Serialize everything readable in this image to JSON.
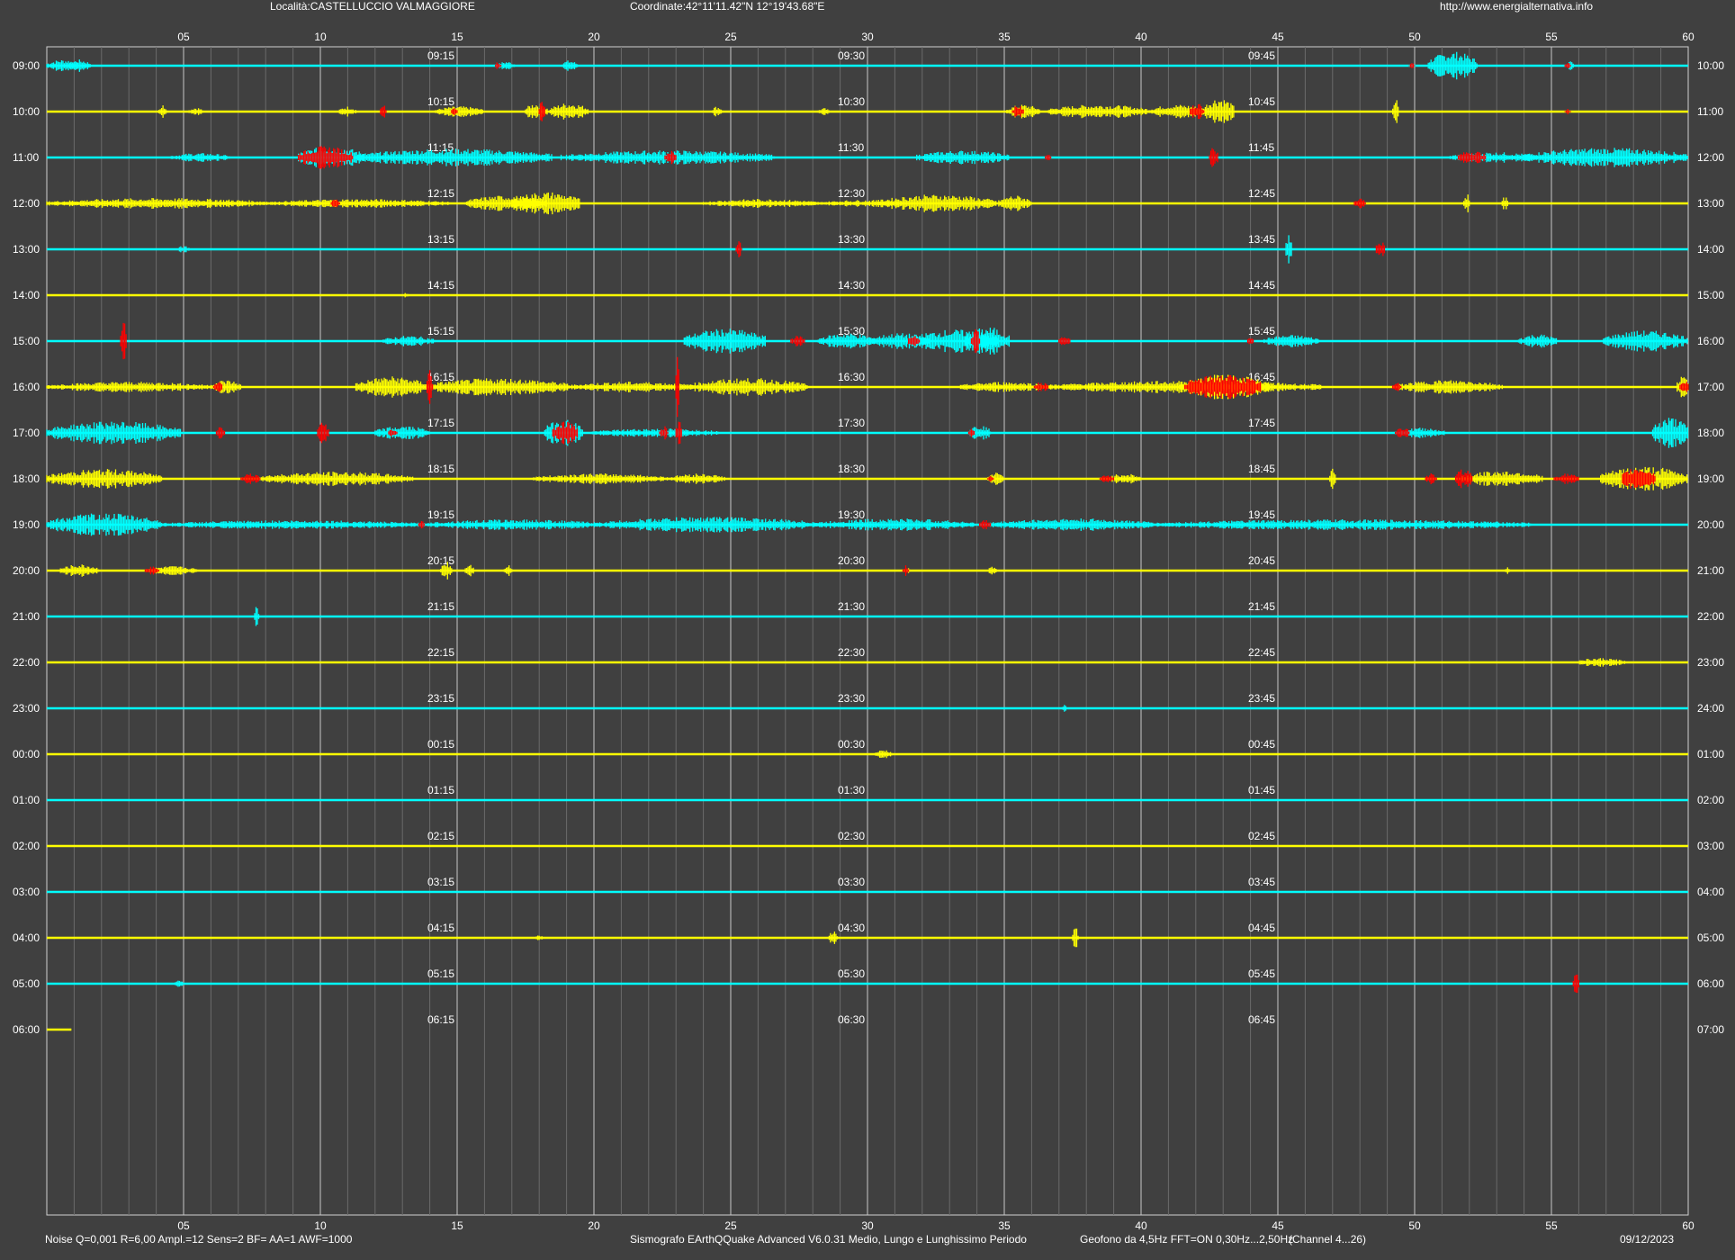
{
  "header": {
    "location": "Località:CASTELLUCCIO VALMAGGIORE",
    "coordinates": "Coordinate:42°11'11.42\"N  12°19'43.68\"E",
    "website": "http://www.energialternativa.info"
  },
  "footer": {
    "params": "Noise Q=0,001 R=6,00 Ampl.=12 Sens=2 BF= AA=1 AWF=1000",
    "software": "Sismografo  EArthQQuake Advanced V6.0.31  Medio, Lungo e Lunghissimo Periodo",
    "sensor": "Geofono da 4,5Hz FFT=ON 0,30Hz...2,50Hz",
    "channel": "(Channel 4...26)",
    "date": "09/12/2023"
  },
  "colors": {
    "background": "#404040",
    "grid": "#9a9a9a",
    "cyan": "#00ffff",
    "yellow": "#ffff00",
    "event": "#ff0000",
    "text": "#ffffff"
  },
  "chart_data": {
    "type": "line",
    "subtype": "helicorder",
    "xlim": [
      0,
      60
    ],
    "x_ticks": [
      "05",
      "10",
      "15",
      "20",
      "25",
      "30",
      "35",
      "40",
      "45",
      "50",
      "55",
      "60"
    ],
    "rows": [
      {
        "left": "09:00",
        "right": "10:00",
        "marks": [
          "09:15",
          "09:30",
          "09:45"
        ],
        "color": "cyan",
        "bursts": [
          [
            0,
            1.2,
            0.7
          ],
          [
            0.8,
            0.8,
            0.7
          ],
          [
            16.5,
            0.6,
            0.5
          ],
          [
            18.8,
            0.6,
            0.6
          ],
          [
            50.5,
            1.8,
            1.6
          ],
          [
            55.6,
            0.2,
            0.6
          ]
        ],
        "events": [
          [
            16.4,
            0.2,
            0.5
          ],
          [
            49.8,
            0.2,
            0.3
          ],
          [
            55.5,
            0.2,
            0.5
          ]
        ]
      },
      {
        "left": "10:00",
        "right": "11:00",
        "marks": [
          "10:15",
          "10:30",
          "10:45"
        ],
        "color": "yellow",
        "bursts": [
          [
            4.1,
            0.3,
            0.8
          ],
          [
            5.2,
            0.5,
            0.5
          ],
          [
            10.7,
            0.6,
            0.6
          ],
          [
            14.2,
            1.8,
            0.6
          ],
          [
            17.5,
            0.8,
            1.0
          ],
          [
            18.4,
            1.4,
            1.0
          ],
          [
            24.3,
            0.4,
            0.6
          ],
          [
            28.2,
            0.4,
            0.4
          ],
          [
            35.1,
            1.2,
            0.8
          ],
          [
            36.6,
            3.7,
            0.8
          ],
          [
            40.3,
            2.1,
            0.8
          ],
          [
            42.3,
            1.1,
            1.6
          ],
          [
            49.2,
            0.2,
            1.6
          ]
        ],
        "events": [
          [
            12.2,
            0.2,
            0.9
          ],
          [
            14.8,
            0.2,
            0.5
          ],
          [
            18.0,
            0.2,
            1.8
          ],
          [
            35.3,
            0.4,
            0.7
          ],
          [
            41.8,
            0.5,
            1.0
          ],
          [
            55.5,
            0.2,
            0.3
          ]
        ]
      },
      {
        "left": "11:00",
        "right": "12:00",
        "marks": [
          "11:15",
          "11:30",
          "11:45"
        ],
        "color": "cyan",
        "bursts": [
          [
            4.5,
            2.2,
            0.5
          ],
          [
            9.2,
            2.4,
            1.3
          ],
          [
            11.3,
            7.2,
            1.0
          ],
          [
            18.8,
            7.8,
            0.8
          ],
          [
            31.8,
            3.4,
            0.8
          ],
          [
            51.3,
            3.2,
            0.6
          ],
          [
            54.0,
            6.0,
            1.1
          ]
        ],
        "events": [
          [
            9.2,
            2.0,
            1.3
          ],
          [
            22.6,
            0.4,
            0.8
          ],
          [
            36.5,
            0.2,
            0.5
          ],
          [
            42.5,
            0.3,
            1.4
          ],
          [
            51.6,
            1.0,
            0.8
          ]
        ]
      },
      {
        "left": "12:00",
        "right": "13:00",
        "marks": [
          "12:15",
          "12:30",
          "12:45"
        ],
        "color": "yellow",
        "bursts": [
          [
            0,
            8.2,
            0.6
          ],
          [
            8.2,
            6.5,
            0.5
          ],
          [
            15.3,
            3.0,
            0.9
          ],
          [
            17.0,
            2.5,
            1.3
          ],
          [
            24.0,
            4.2,
            0.5
          ],
          [
            28.3,
            3.1,
            0.4
          ],
          [
            30.4,
            4.3,
            1.0
          ],
          [
            34.8,
            1.2,
            0.9
          ],
          [
            51.8,
            0.2,
            1.2
          ],
          [
            53.2,
            0.2,
            0.8
          ]
        ],
        "events": [
          [
            10.4,
            0.3,
            0.5
          ],
          [
            47.8,
            0.4,
            0.8
          ]
        ]
      },
      {
        "left": "13:00",
        "right": "14:00",
        "marks": [
          "13:15",
          "13:30",
          "13:45"
        ],
        "color": "cyan",
        "bursts": [
          [
            4.8,
            0.4,
            0.4
          ],
          [
            45.3,
            0.2,
            2.0
          ]
        ],
        "events": [
          [
            25.2,
            0.2,
            0.9
          ],
          [
            48.6,
            0.3,
            1.1
          ]
        ]
      },
      {
        "left": "14:00",
        "right": "15:00",
        "marks": [
          "14:15",
          "14:30",
          "14:45"
        ],
        "color": "yellow",
        "bursts": [
          [
            13.0,
            0.3,
            0.3
          ]
        ],
        "events": []
      },
      {
        "left": "15:00",
        "right": "16:00",
        "marks": [
          "15:15",
          "15:30",
          "15:45"
        ],
        "color": "cyan",
        "bursts": [
          [
            12.3,
            1.9,
            0.6
          ],
          [
            23.3,
            3.0,
            1.4
          ],
          [
            28.2,
            2.1,
            0.9
          ],
          [
            30.1,
            2.2,
            0.9
          ],
          [
            31.6,
            3.2,
            1.3
          ],
          [
            33.6,
            1.6,
            1.6
          ],
          [
            44.5,
            2.0,
            0.7
          ],
          [
            53.8,
            1.4,
            0.8
          ],
          [
            56.9,
            3.1,
            1.2
          ]
        ],
        "events": [
          [
            2.7,
            0.2,
            3.5
          ],
          [
            27.2,
            0.5,
            0.6
          ],
          [
            31.5,
            0.4,
            0.8
          ],
          [
            33.8,
            0.3,
            1.7
          ],
          [
            37.0,
            0.4,
            0.6
          ],
          [
            43.9,
            0.2,
            0.5
          ]
        ]
      },
      {
        "left": "16:00",
        "right": "17:00",
        "marks": [
          "16:15",
          "16:30",
          "16:45"
        ],
        "color": "yellow",
        "bursts": [
          [
            0,
            6.0,
            0.6
          ],
          [
            6.0,
            1.1,
            0.8
          ],
          [
            11.3,
            2.6,
            1.2
          ],
          [
            13.9,
            5.2,
            1.0
          ],
          [
            19.1,
            4.6,
            0.6
          ],
          [
            23.5,
            4.3,
            1.0
          ],
          [
            33.4,
            3.2,
            0.6
          ],
          [
            36.6,
            10.0,
            0.7
          ],
          [
            41.4,
            3.3,
            1.4
          ],
          [
            49.4,
            3.8,
            0.8
          ],
          [
            59.6,
            0.4,
            1.4
          ]
        ],
        "events": [
          [
            6.1,
            0.3,
            0.8
          ],
          [
            13.9,
            0.2,
            1.9
          ],
          [
            23.0,
            0.1,
            6.0
          ],
          [
            36.1,
            0.5,
            0.6
          ],
          [
            41.6,
            2.8,
            1.4
          ],
          [
            49.2,
            0.3,
            0.5
          ],
          [
            59.7,
            0.3,
            1.0
          ]
        ]
      },
      {
        "left": "17:00",
        "right": "18:00",
        "marks": [
          "17:15",
          "17:30",
          "17:45"
        ],
        "color": "cyan",
        "bursts": [
          [
            0,
            4.9,
            1.3
          ],
          [
            12.0,
            2.0,
            0.8
          ],
          [
            18.2,
            1.4,
            1.6
          ],
          [
            19.9,
            4.8,
            0.5
          ],
          [
            33.7,
            0.8,
            0.9
          ],
          [
            49.5,
            1.6,
            0.6
          ],
          [
            58.7,
            1.3,
            1.8
          ]
        ],
        "events": [
          [
            6.2,
            0.3,
            0.8
          ],
          [
            9.9,
            0.4,
            1.3
          ],
          [
            12.5,
            0.3,
            0.5
          ],
          [
            18.5,
            0.9,
            1.4
          ],
          [
            22.4,
            0.3,
            0.9
          ],
          [
            23.0,
            0.2,
            1.5
          ],
          [
            33.7,
            0.2,
            0.5
          ],
          [
            49.3,
            0.5,
            0.7
          ]
        ]
      },
      {
        "left": "18:00",
        "right": "19:00",
        "marks": [
          "18:15",
          "18:30",
          "18:45"
        ],
        "color": "yellow",
        "bursts": [
          [
            0,
            4.2,
            1.1
          ],
          [
            7.7,
            5.7,
            0.8
          ],
          [
            17.8,
            4.9,
            0.6
          ],
          [
            22.8,
            2.0,
            0.6
          ],
          [
            34.4,
            0.6,
            0.7
          ],
          [
            38.8,
            1.2,
            0.6
          ],
          [
            46.9,
            0.2,
            1.4
          ],
          [
            51.7,
            3.0,
            0.9
          ],
          [
            56.8,
            3.2,
            1.4
          ]
        ],
        "events": [
          [
            7.1,
            0.7,
            0.6
          ],
          [
            34.4,
            0.2,
            0.5
          ],
          [
            38.5,
            0.5,
            0.5
          ],
          [
            50.4,
            0.4,
            0.6
          ],
          [
            51.5,
            0.6,
            1.2
          ],
          [
            55.1,
            0.9,
            0.6
          ],
          [
            57.6,
            1.2,
            1.4
          ]
        ]
      },
      {
        "left": "19:00",
        "right": "20:00",
        "marks": [
          "19:15",
          "19:30",
          "19:45"
        ],
        "color": "cyan",
        "bursts": [
          [
            0,
            4.2,
            1.3
          ],
          [
            4.2,
            9.6,
            0.5
          ],
          [
            13.8,
            6.6,
            0.6
          ],
          [
            20.4,
            7.7,
            0.9
          ],
          [
            28.1,
            5.8,
            0.7
          ],
          [
            34.5,
            6.1,
            0.7
          ],
          [
            40.6,
            13.7,
            0.6
          ]
        ],
        "events": [
          [
            13.6,
            0.2,
            0.5
          ],
          [
            34.1,
            0.4,
            0.6
          ]
        ]
      },
      {
        "left": "20:00",
        "right": "21:00",
        "marks": [
          "20:15",
          "20:30",
          "20:45"
        ],
        "color": "yellow",
        "bursts": [
          [
            0.5,
            1.4,
            0.7
          ],
          [
            3.7,
            1.8,
            0.5
          ],
          [
            14.4,
            0.4,
            1.1
          ],
          [
            15.3,
            0.3,
            0.9
          ],
          [
            16.7,
            0.3,
            0.7
          ],
          [
            31.4,
            0.2,
            0.3
          ],
          [
            34.4,
            0.3,
            0.6
          ],
          [
            53.3,
            0.2,
            0.4
          ]
        ],
        "events": [
          [
            3.6,
            0.5,
            0.5
          ],
          [
            31.3,
            0.2,
            0.6
          ]
        ]
      },
      {
        "left": "21:00",
        "right": "22:00",
        "marks": [
          "21:15",
          "21:30",
          "21:45"
        ],
        "color": "cyan",
        "bursts": [
          [
            7.6,
            0.15,
            1.4
          ]
        ],
        "events": []
      },
      {
        "left": "22:00",
        "right": "23:00",
        "marks": [
          "22:15",
          "22:30",
          "22:45"
        ],
        "color": "yellow",
        "bursts": [
          [
            55.9,
            1.8,
            0.5
          ]
        ],
        "events": []
      },
      {
        "left": "23:00",
        "right": "24:00",
        "marks": [
          "23:15",
          "23:30",
          "23:45"
        ],
        "color": "cyan",
        "bursts": [
          [
            37.1,
            0.2,
            0.4
          ]
        ],
        "events": []
      },
      {
        "left": "00:00",
        "right": "01:00",
        "marks": [
          "00:15",
          "00:30",
          "00:45"
        ],
        "color": "yellow",
        "bursts": [
          [
            30.3,
            0.6,
            0.5
          ]
        ],
        "events": []
      },
      {
        "left": "01:00",
        "right": "02:00",
        "marks": [
          "01:15",
          "01:30",
          "01:45"
        ],
        "color": "cyan",
        "bursts": [],
        "events": []
      },
      {
        "left": "02:00",
        "right": "03:00",
        "marks": [
          "02:15",
          "02:30",
          "02:45"
        ],
        "color": "yellow",
        "bursts": [],
        "events": []
      },
      {
        "left": "03:00",
        "right": "04:00",
        "marks": [
          "03:15",
          "03:30",
          "03:45"
        ],
        "color": "cyan",
        "bursts": [],
        "events": []
      },
      {
        "left": "04:00",
        "right": "05:00",
        "marks": [
          "04:15",
          "04:30",
          "04:45"
        ],
        "color": "yellow",
        "bursts": [
          [
            17.9,
            0.2,
            0.4
          ],
          [
            28.6,
            0.3,
            0.8
          ],
          [
            37.5,
            0.2,
            1.3
          ]
        ],
        "events": []
      },
      {
        "left": "05:00",
        "right": "06:00",
        "marks": [
          "05:15",
          "05:30",
          "05:45"
        ],
        "color": "cyan",
        "bursts": [
          [
            4.7,
            0.3,
            0.4
          ]
        ],
        "events": [
          [
            55.8,
            0.2,
            1.3
          ]
        ]
      },
      {
        "left": "06:00",
        "right": "07:00",
        "marks": [
          "06:15",
          "06:30",
          "06:45"
        ],
        "color": "yellow",
        "extent": 0.9,
        "bursts": [],
        "events": []
      }
    ]
  }
}
